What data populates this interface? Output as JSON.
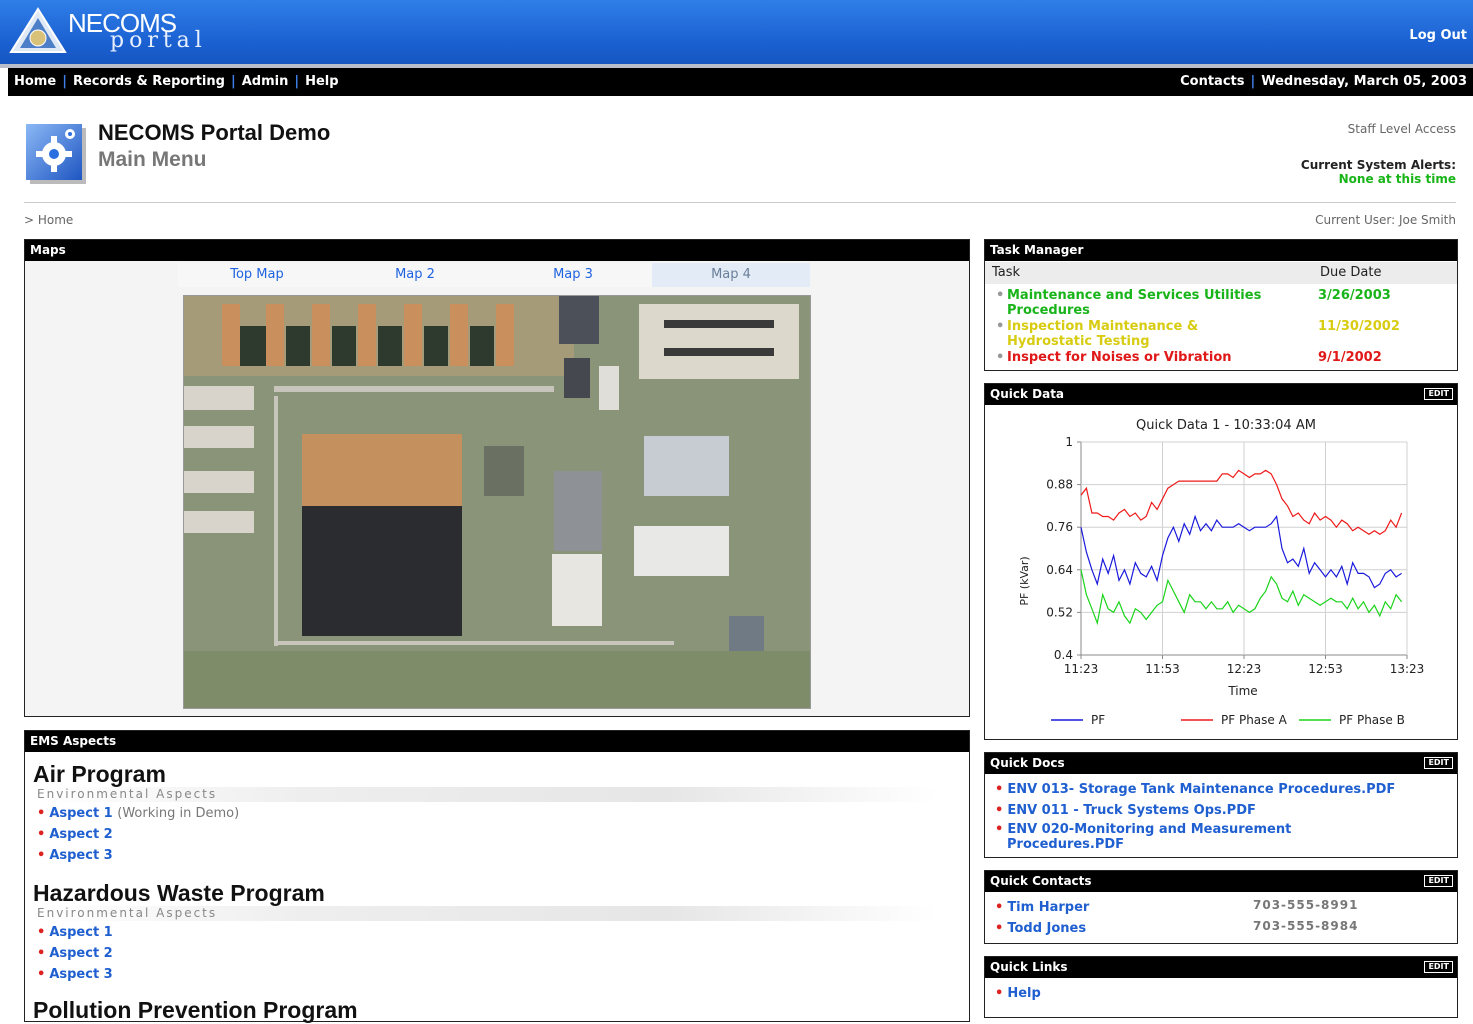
{
  "header": {
    "logo_top": "NECOMS",
    "logo_bottom": "portal",
    "logout": "Log Out"
  },
  "nav": {
    "items": [
      "Home",
      "Records & Reporting",
      "Admin",
      "Help"
    ],
    "contacts": "Contacts",
    "date": "Wednesday, March 05, 2003"
  },
  "page": {
    "title": "NECOMS Portal Demo",
    "subtitle": "Main Menu",
    "access": "Staff Level Access",
    "alerts_label": "Current System Alerts:",
    "alerts_value": "None at this time",
    "breadcrumb": "> Home",
    "current_user": "Current User: Joe Smith"
  },
  "maps": {
    "title": "Maps",
    "tabs": [
      "Top Map",
      "Map 2",
      "Map 3",
      "Map 4"
    ],
    "active_tab": "Map 4"
  },
  "ems": {
    "title": "EMS Aspects",
    "programs": [
      {
        "name": "Air Program",
        "sub": "Environmental Aspects",
        "aspects": [
          "Aspect 1",
          "Aspect 2",
          "Aspect 3"
        ],
        "note": "(Working in Demo)"
      },
      {
        "name": "Hazardous Waste Program",
        "sub": "Environmental Aspects",
        "aspects": [
          "Aspect 1",
          "Aspect 2",
          "Aspect 3"
        ]
      },
      {
        "name": "Pollution Prevention Program"
      }
    ]
  },
  "task_manager": {
    "title": "Task Manager",
    "col_task": "Task",
    "col_due": "Due Date",
    "tasks": [
      {
        "task": "Maintenance and Services Utilities Procedures",
        "due": "3/26/2003",
        "color": "#19b419"
      },
      {
        "task": "Inspection Maintenance & Hydrostatic Testing",
        "due": "11/30/2002",
        "color": "#d8cc12"
      },
      {
        "task": "Inspect for Noises or Vibration",
        "due": "9/1/2002",
        "color": "#e01818"
      }
    ]
  },
  "quick_data": {
    "title": "Quick Data",
    "edit": "EDIT"
  },
  "chart_data": {
    "type": "line",
    "title": "Quick Data 1 - 10:33:04 AM",
    "xlabel": "Time",
    "ylabel": "PF (kVar)",
    "xticks": [
      "11:23",
      "11:53",
      "12:23",
      "12:53",
      "13:23"
    ],
    "yticks": [
      0.4,
      0.52,
      0.64,
      0.76,
      0.88,
      1
    ],
    "ylim": [
      0.4,
      1
    ],
    "xlim_minutes_from_1123": [
      0,
      120
    ],
    "x": [
      0,
      2,
      4,
      6,
      8,
      10,
      12,
      14,
      16,
      18,
      20,
      22,
      24,
      26,
      28,
      30,
      32,
      34,
      36,
      38,
      40,
      42,
      44,
      46,
      48,
      50,
      52,
      54,
      56,
      58,
      60,
      62,
      64,
      66,
      68,
      70,
      72,
      74,
      76,
      78,
      80,
      82,
      84,
      86,
      88,
      90,
      92,
      94,
      96,
      98,
      100,
      102,
      104,
      106,
      108,
      110,
      112,
      114,
      116,
      118
    ],
    "series": [
      {
        "name": "PF",
        "color": "#1a1adc",
        "values": [
          0.76,
          0.69,
          0.64,
          0.6,
          0.67,
          0.63,
          0.68,
          0.61,
          0.64,
          0.6,
          0.66,
          0.63,
          0.62,
          0.65,
          0.61,
          0.68,
          0.73,
          0.76,
          0.72,
          0.77,
          0.74,
          0.79,
          0.75,
          0.77,
          0.75,
          0.78,
          0.76,
          0.76,
          0.76,
          0.77,
          0.76,
          0.75,
          0.76,
          0.76,
          0.76,
          0.77,
          0.79,
          0.7,
          0.66,
          0.67,
          0.65,
          0.7,
          0.63,
          0.66,
          0.64,
          0.62,
          0.64,
          0.62,
          0.65,
          0.6,
          0.66,
          0.63,
          0.63,
          0.62,
          0.59,
          0.6,
          0.63,
          0.64,
          0.62,
          0.63
        ]
      },
      {
        "name": "PF Phase A",
        "color": "#ee1a1a",
        "values": [
          0.85,
          0.87,
          0.8,
          0.8,
          0.79,
          0.79,
          0.78,
          0.8,
          0.81,
          0.79,
          0.8,
          0.78,
          0.79,
          0.83,
          0.81,
          0.84,
          0.87,
          0.88,
          0.89,
          0.89,
          0.89,
          0.89,
          0.89,
          0.89,
          0.89,
          0.89,
          0.91,
          0.91,
          0.9,
          0.92,
          0.91,
          0.9,
          0.91,
          0.91,
          0.92,
          0.91,
          0.88,
          0.84,
          0.82,
          0.79,
          0.8,
          0.78,
          0.77,
          0.8,
          0.78,
          0.79,
          0.78,
          0.76,
          0.78,
          0.77,
          0.75,
          0.76,
          0.75,
          0.74,
          0.75,
          0.74,
          0.75,
          0.78,
          0.76,
          0.8
        ]
      },
      {
        "name": "PF Phase B",
        "color": "#1ad41a",
        "values": [
          0.64,
          0.57,
          0.53,
          0.49,
          0.57,
          0.53,
          0.52,
          0.55,
          0.51,
          0.49,
          0.53,
          0.52,
          0.5,
          0.52,
          0.54,
          0.55,
          0.61,
          0.58,
          0.55,
          0.52,
          0.57,
          0.55,
          0.55,
          0.53,
          0.55,
          0.53,
          0.53,
          0.55,
          0.52,
          0.54,
          0.53,
          0.52,
          0.53,
          0.56,
          0.58,
          0.62,
          0.6,
          0.56,
          0.55,
          0.58,
          0.54,
          0.57,
          0.56,
          0.55,
          0.54,
          0.55,
          0.56,
          0.55,
          0.55,
          0.53,
          0.56,
          0.53,
          0.55,
          0.52,
          0.54,
          0.51,
          0.55,
          0.53,
          0.57,
          0.55
        ]
      }
    ],
    "legend_position": "bottom"
  },
  "quick_docs": {
    "title": "Quick Docs",
    "edit": "EDIT",
    "docs": [
      "ENV 013- Storage Tank Maintenance Procedures.PDF",
      "ENV 011 - Truck Systems Ops.PDF",
      "ENV 020-Monitoring and Measurement Procedures.PDF"
    ]
  },
  "quick_contacts": {
    "title": "Quick Contacts",
    "edit": "EDIT",
    "contacts": [
      {
        "name": "Tim Harper",
        "phone": "703-555-8991"
      },
      {
        "name": "Todd Jones",
        "phone": "703-555-8984"
      }
    ]
  },
  "quick_links": {
    "title": "Quick Links",
    "edit": "EDIT",
    "links": [
      "Help"
    ]
  }
}
